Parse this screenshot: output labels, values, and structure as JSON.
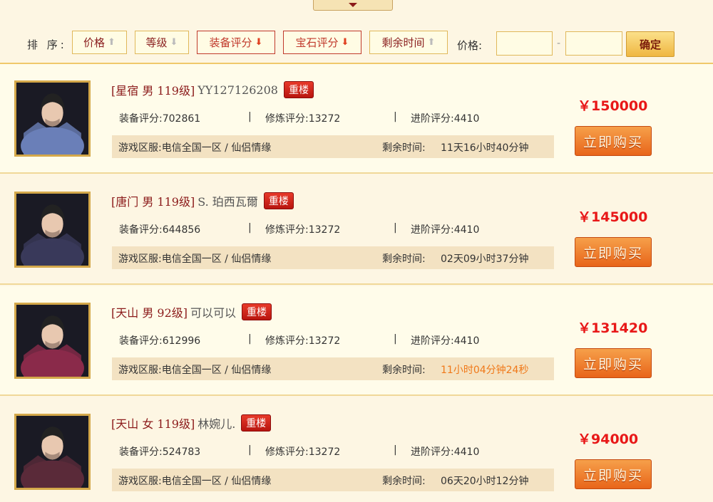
{
  "sort": {
    "label": "排 序:",
    "buttons": [
      {
        "label": "价格",
        "dir": "up",
        "active": false
      },
      {
        "label": "等级",
        "dir": "down",
        "active": false
      },
      {
        "label": "装备评分",
        "dir": "down",
        "active": true
      },
      {
        "label": "宝石评分",
        "dir": "down",
        "active": true
      },
      {
        "label": "剩余时间",
        "dir": "up",
        "active": false
      }
    ],
    "price_label": "价格:",
    "price_min": "",
    "price_max": "",
    "dash": "-",
    "confirm": "确定"
  },
  "listings": [
    {
      "class_level": "[星宿 男 119级]",
      "name": "YY127126208",
      "badge": "重楼",
      "equip_score": "装备评分:702861",
      "cultivate_score": "修炼评分:13272",
      "advance_score": "进阶评分:4410",
      "server": "游戏区服:电信全国一区 / 仙侣情缘",
      "time_label": "剩余时间:",
      "time_value": "11天16小时40分钟",
      "urgent": false,
      "price": "￥150000",
      "buy": "立即购买",
      "theme": "#6a7fb8"
    },
    {
      "class_level": "[唐门 男 119级]",
      "name": "S. 珀西瓦爾",
      "badge": "重楼",
      "equip_score": "装备评分:644856",
      "cultivate_score": "修炼评分:13272",
      "advance_score": "进阶评分:4410",
      "server": "游戏区服:电信全国一区 / 仙侣情缘",
      "time_label": "剩余时间:",
      "time_value": "02天09小时37分钟",
      "urgent": false,
      "price": "￥145000",
      "buy": "立即购买",
      "theme": "#3a3a5a"
    },
    {
      "class_level": "[天山 男 92级]",
      "name": "可以可以",
      "badge": "重楼",
      "equip_score": "装备评分:612996",
      "cultivate_score": "修炼评分:13272",
      "advance_score": "进阶评分:4410",
      "server": "游戏区服:电信全国一区 / 仙侣情缘",
      "time_label": "剩余时间:",
      "time_value": "11小时04分钟24秒",
      "urgent": true,
      "price": "￥131420",
      "buy": "立即购买",
      "theme": "#8a2a4a"
    },
    {
      "class_level": "[天山 女 119级]",
      "name": "林婉儿.",
      "badge": "重楼",
      "equip_score": "装备评分:524783",
      "cultivate_score": "修炼评分:13272",
      "advance_score": "进阶评分:4410",
      "server": "游戏区服:电信全国一区 / 仙侣情缘",
      "time_label": "剩余时间:",
      "time_value": "06天20小时12分钟",
      "urgent": false,
      "price": "￥94000",
      "buy": "立即购买",
      "theme": "#5a2a3a"
    }
  ]
}
